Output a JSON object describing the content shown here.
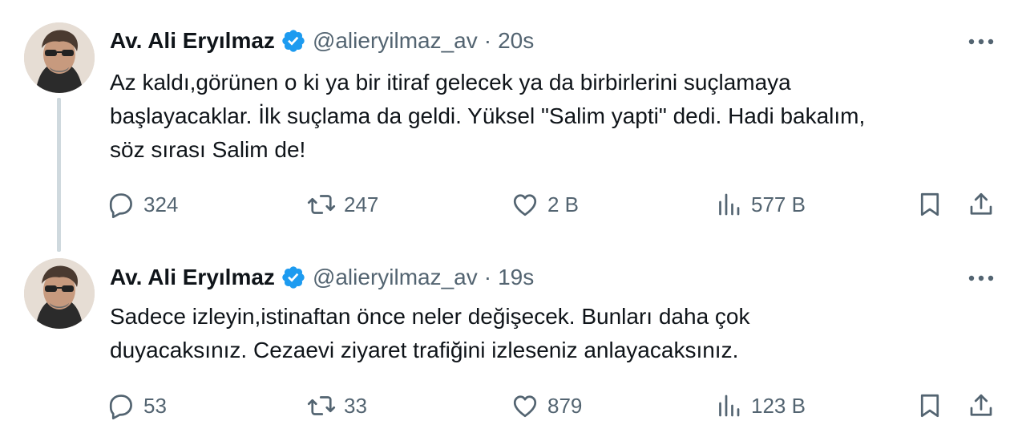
{
  "colors": {
    "text": "#0f1419",
    "secondary": "#536471",
    "verified_badge": "#1d9bf0",
    "thread_line": "#cfd9de"
  },
  "tweets": [
    {
      "display_name": "Av. Ali Eryılmaz",
      "handle": "@alieryilmaz_av",
      "separator": "·",
      "time": "20s",
      "text": "Az kaldı,görünen o ki ya bir itiraf gelecek ya da birbirlerini suçlamaya\nbaşlayacaklar. İlk suçlama da geldi. Yüksel \"Salim yapti\" dedi. Hadi bakalım,\nsöz sırası Salim de!",
      "replies": "324",
      "reposts": "247",
      "likes": "2 B",
      "views": "577 B"
    },
    {
      "display_name": "Av. Ali Eryılmaz",
      "handle": "@alieryilmaz_av",
      "separator": "·",
      "time": "19s",
      "text": "Sadece izleyin,istinaftan önce neler değişecek. Bunları daha çok\nduyacaksınız. Cezaevi ziyaret trafiğini izleseniz anlayacaksınız.",
      "replies": "53",
      "reposts": "33",
      "likes": "879",
      "views": "123 B"
    }
  ],
  "icons": {
    "verified": "verified-badge-icon",
    "more": "more-horizontal-icon",
    "reply": "reply-bubble-icon",
    "repost": "repost-arrows-icon",
    "like": "heart-icon",
    "views": "bar-chart-icon",
    "bookmark": "bookmark-icon",
    "share": "share-upload-icon"
  }
}
